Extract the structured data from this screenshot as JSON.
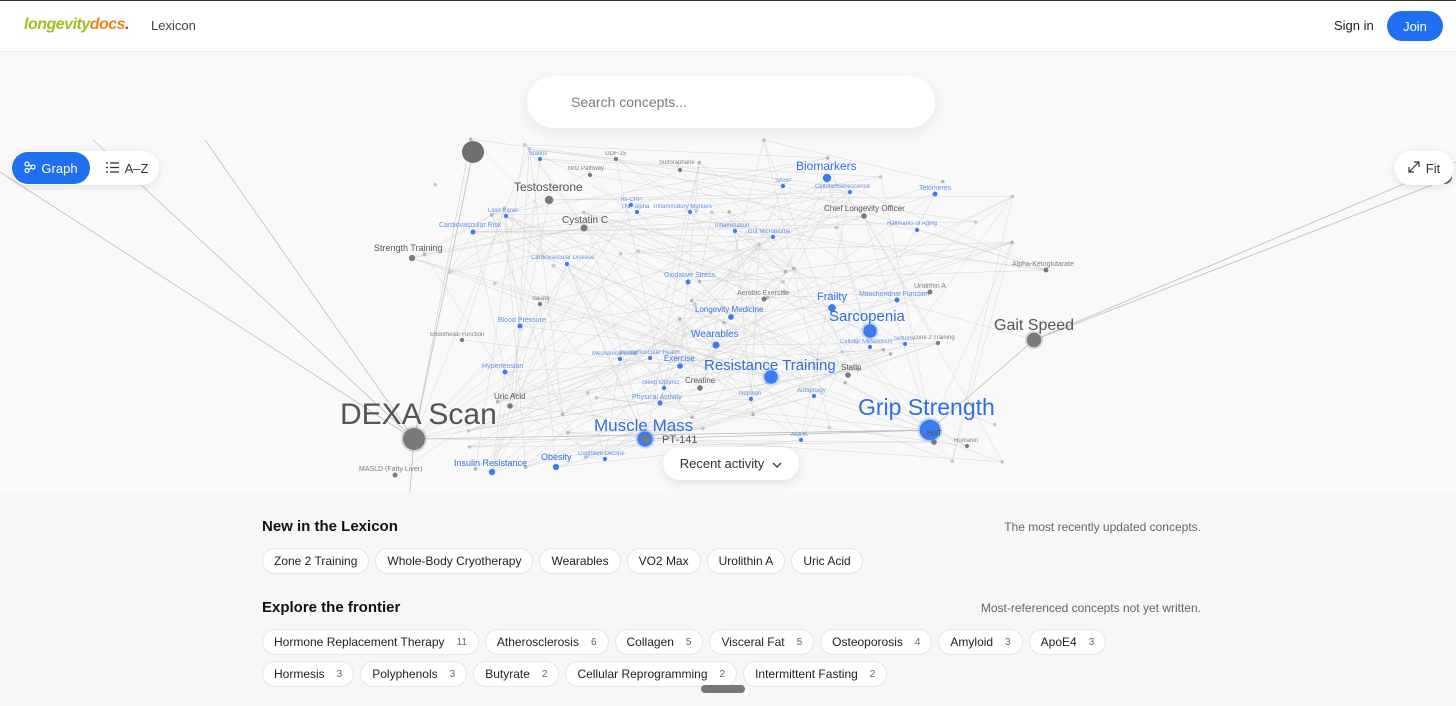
{
  "brand": {
    "part1": "longevity",
    "part2": "docs",
    "part3": "."
  },
  "nav": {
    "section": "Lexicon",
    "signin": "Sign in",
    "join": "Join"
  },
  "search": {
    "placeholder": "Search concepts..."
  },
  "view_toggle": {
    "graph": "Graph",
    "az": "A–Z",
    "fit": "Fit"
  },
  "recent": {
    "label": "Recent activity"
  },
  "graph_labels": [
    {
      "text": "DEXA Scan",
      "color": "grey",
      "size": 30
    },
    {
      "text": "Grip Strength",
      "color": "blue",
      "size": 23
    },
    {
      "text": "Muscle Mass",
      "color": "blue",
      "size": 17
    },
    {
      "text": "Resistance Training",
      "color": "blue",
      "size": 15
    },
    {
      "text": "Sarcopenia",
      "color": "blue",
      "size": 15
    },
    {
      "text": "Gait Speed",
      "color": "grey",
      "size": 16
    },
    {
      "text": "Biomarkers",
      "color": "blue",
      "size": 12
    },
    {
      "text": "Testosterone",
      "color": "grey",
      "size": 12
    },
    {
      "text": "Frailty",
      "color": "blue",
      "size": 11
    },
    {
      "text": "Cystatin C",
      "color": "grey",
      "size": 10
    },
    {
      "text": "Wearables",
      "color": "blue",
      "size": 10
    },
    {
      "text": "Creatine",
      "color": "grey",
      "size": 8
    },
    {
      "text": "Uric Acid",
      "color": "grey",
      "size": 8
    },
    {
      "text": "Obesity",
      "color": "blue",
      "size": 9
    },
    {
      "text": "Insulin Resistance",
      "color": "blue",
      "size": 9
    },
    {
      "text": "PT-141",
      "color": "grey",
      "size": 11
    },
    {
      "text": "Strength Training",
      "color": "grey",
      "size": 9
    },
    {
      "text": "Chief Longevity Officer",
      "color": "grey",
      "size": 8
    },
    {
      "text": "Longevity Medicine",
      "color": "blue",
      "size": 8
    },
    {
      "text": "Exercise",
      "color": "blue",
      "size": 8
    },
    {
      "text": "HIIT",
      "color": "grey",
      "size": 8
    },
    {
      "text": "Hypertension",
      "color": "blue",
      "size": 7
    },
    {
      "text": "Oxidative Stress",
      "color": "blue",
      "size": 7
    },
    {
      "text": "Aerobic Exercise",
      "color": "grey",
      "size": 7
    },
    {
      "text": "Mitochondrial Function",
      "color": "blue",
      "size": 7
    },
    {
      "text": "Urolithin A",
      "color": "grey",
      "size": 7
    },
    {
      "text": "Telomeres",
      "color": "blue",
      "size": 7
    },
    {
      "text": "Cardiovascular Risk",
      "color": "blue",
      "size": 7
    },
    {
      "text": "Blood Pressure",
      "color": "blue",
      "size": 7
    },
    {
      "text": "Physical Activity",
      "color": "blue",
      "size": 7
    },
    {
      "text": "Alpha-Ketoglutarate",
      "color": "grey",
      "size": 7
    },
    {
      "text": "MASLD (Fatty Liver)",
      "color": "grey",
      "size": 7
    },
    {
      "text": "Nrf2 Pathway",
      "color": "grey",
      "size": 6
    },
    {
      "text": "Sulforaphane",
      "color": "grey",
      "size": 6
    },
    {
      "text": "Inflammatory Markers",
      "color": "blue",
      "size": 6
    },
    {
      "text": "Gut Microbiome",
      "color": "blue",
      "size": 6
    },
    {
      "text": "Lipid Panel",
      "color": "blue",
      "size": 6
    },
    {
      "text": "Cardiovascular Disease",
      "color": "blue",
      "size": 6
    },
    {
      "text": "Endothelial Function",
      "color": "grey",
      "size": 6
    },
    {
      "text": "Sauna",
      "color": "grey",
      "size": 6
    },
    {
      "text": "Statins",
      "color": "blue",
      "size": 6
    },
    {
      "text": "GDF-15",
      "color": "grey",
      "size": 6
    },
    {
      "text": "Cellular Senescence",
      "color": "blue",
      "size": 6
    },
    {
      "text": "Hallmarks of Aging",
      "color": "blue",
      "size": 6
    },
    {
      "text": "Cellular Metabolism",
      "color": "blue",
      "size": 6
    },
    {
      "text": "Zone 2 Training",
      "color": "grey",
      "size": 6
    },
    {
      "text": "Nutrition",
      "color": "blue",
      "size": 6
    },
    {
      "text": "Autophagy",
      "color": "blue",
      "size": 6
    },
    {
      "text": "AMPK",
      "color": "blue",
      "size": 6
    },
    {
      "text": "Cognitive Decline",
      "color": "blue",
      "size": 6
    },
    {
      "text": "Sleep Optimiz",
      "color": "blue",
      "size": 6
    },
    {
      "text": "Sirtuins",
      "color": "blue",
      "size": 6
    },
    {
      "text": "Statin",
      "color": "grey",
      "size": 8
    },
    {
      "text": "Humanin",
      "color": "grey",
      "size": 6
    },
    {
      "text": "hs-CRP",
      "color": "blue",
      "size": 6
    },
    {
      "text": "TNF-alpha",
      "color": "blue",
      "size": 6
    },
    {
      "text": "Inflammation",
      "color": "blue",
      "size": 6
    },
    {
      "text": "Mechanical Load",
      "color": "blue",
      "size": 6
    },
    {
      "text": "SASP",
      "color": "blue",
      "size": 6
    },
    {
      "text": "Neuromuscular Health",
      "color": "blue",
      "size": 6
    }
  ],
  "new_section": {
    "title": "New in the Lexicon",
    "subtitle": "The most recently updated concepts.",
    "chips": [
      "Zone 2 Training",
      "Whole-Body Cryotherapy",
      "Wearables",
      "VO2 Max",
      "Urolithin A",
      "Uric Acid"
    ]
  },
  "frontier_section": {
    "title": "Explore the frontier",
    "subtitle": "Most-referenced concepts not yet written.",
    "chips": [
      {
        "label": "Hormone Replacement Therapy",
        "count": "11"
      },
      {
        "label": "Atherosclerosis",
        "count": "6"
      },
      {
        "label": "Collagen",
        "count": "5"
      },
      {
        "label": "Visceral Fat",
        "count": "5"
      },
      {
        "label": "Osteoporosis",
        "count": "4"
      },
      {
        "label": "Amyloid",
        "count": "3"
      },
      {
        "label": "ApoE4",
        "count": "3"
      },
      {
        "label": "Hormesis",
        "count": "3"
      },
      {
        "label": "Polyphenols",
        "count": "3"
      },
      {
        "label": "Butyrate",
        "count": "2"
      },
      {
        "label": "Cellular Reprogramming",
        "count": "2"
      },
      {
        "label": "Intermittent Fasting",
        "count": "2"
      }
    ]
  },
  "colors": {
    "accent": "#1f6ff0",
    "node_blue": "#3b7cf0",
    "node_grey": "#7a7a7a"
  },
  "icons": {
    "graph": "graph-nodes-icon",
    "az": "list-icon",
    "fit": "expand-icon",
    "recent": "chevron-down-icon"
  }
}
